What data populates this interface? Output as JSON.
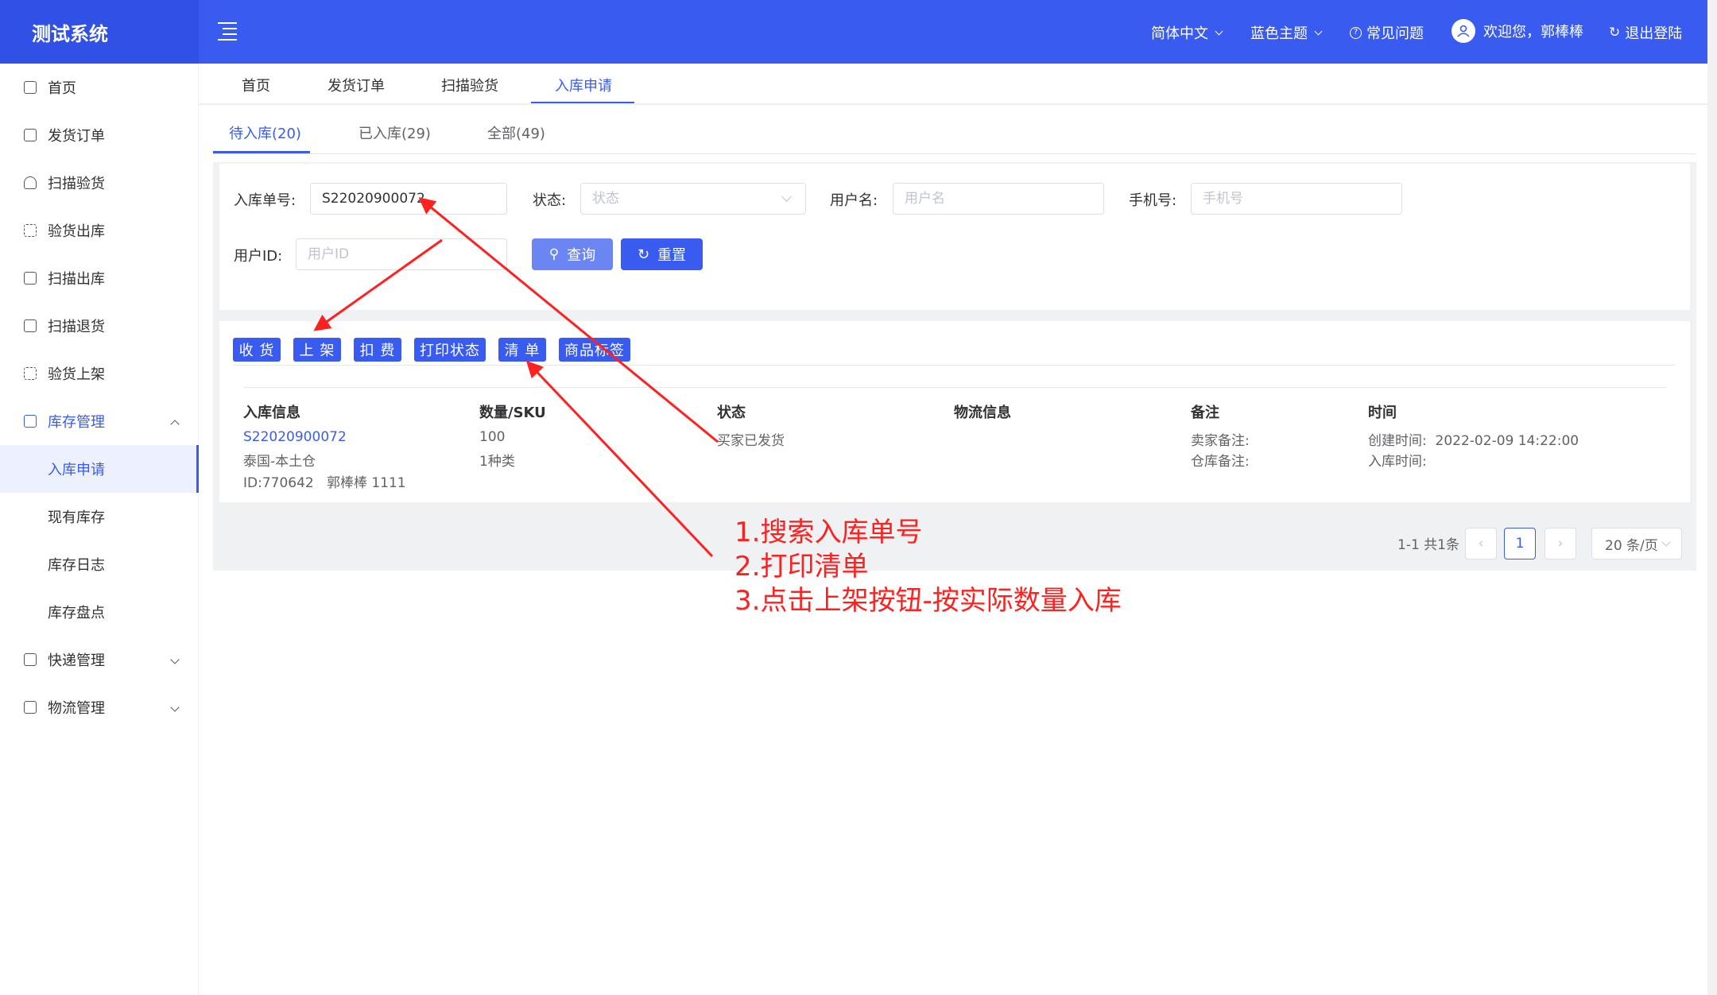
{
  "app": {
    "title": "测试系统"
  },
  "header": {
    "language": "简体中文",
    "theme": "蓝色主题",
    "faq": "常见问题",
    "welcome": "欢迎您，郭棒棒",
    "logout": "退出登陆"
  },
  "sidebar": {
    "items": [
      {
        "label": "首页",
        "icon": "home-icon"
      },
      {
        "label": "发货订单",
        "icon": "bag-icon"
      },
      {
        "label": "扫描验货",
        "icon": "shield-icon"
      },
      {
        "label": "验货出库",
        "icon": "scan-icon"
      },
      {
        "label": "扫描出库",
        "icon": "truck-icon"
      },
      {
        "label": "扫描退货",
        "icon": "return-icon"
      },
      {
        "label": "验货上架",
        "icon": "scan-icon"
      },
      {
        "label": "库存管理",
        "icon": "grid-icon"
      },
      {
        "label": "入库申请"
      },
      {
        "label": "现有库存"
      },
      {
        "label": "库存日志"
      },
      {
        "label": "库存盘点"
      },
      {
        "label": "快递管理",
        "icon": "list-icon"
      },
      {
        "label": "物流管理",
        "icon": "truck-icon"
      }
    ]
  },
  "tabs": [
    "首页",
    "发货订单",
    "扫描验货",
    "入库申请"
  ],
  "subtabs": [
    "待入库(20)",
    "已入库(29)",
    "全部(49)"
  ],
  "filters": {
    "order_no_label": "入库单号:",
    "order_no_value": "S22020900072",
    "status_label": "状态:",
    "status_placeholder": "状态",
    "username_label": "用户名:",
    "username_placeholder": "用户名",
    "phone_label": "手机号:",
    "phone_placeholder": "手机号",
    "userid_label": "用户ID:",
    "userid_placeholder": "用户ID",
    "query": "查询",
    "reset": "重置"
  },
  "actions": [
    "收 货",
    "上 架",
    "扣 费",
    "打印状态",
    "清 单",
    "商品标签"
  ],
  "table": {
    "headers": [
      "入库信息",
      "数量/SKU",
      "状态",
      "物流信息",
      "备注",
      "时间"
    ],
    "row": {
      "order_no": "S22020900072",
      "warehouse": "泰国-本土仓",
      "user": "ID:770642   郭棒棒 1111",
      "qty": "100",
      "sku": "1种类",
      "status": "买家已发货",
      "seller_note": "卖家备注:",
      "warehouse_note": "仓库备注:",
      "created": "创建时间:  2022-02-09 14:22:00",
      "stocked": "入库时间:"
    }
  },
  "pagination": {
    "summary": "1-1 共1条",
    "current": "1",
    "page_size": "20 条/页"
  },
  "annotation": {
    "lines": [
      "1.搜索入库单号",
      "2.打印清单",
      "3.点击上架按钮-按实际数量入库"
    ],
    "color": "#ff2020"
  }
}
